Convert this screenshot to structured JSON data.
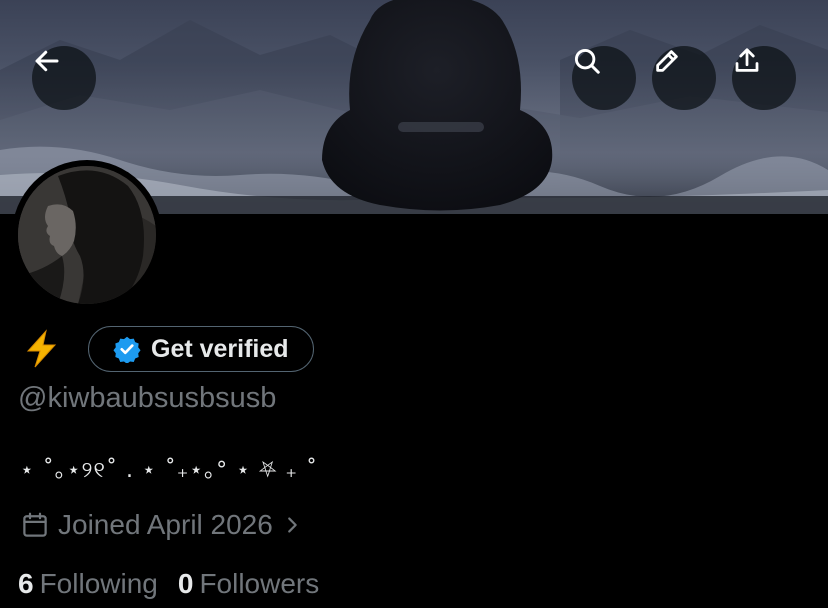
{
  "header": {
    "back_icon": "arrow-left-icon",
    "actions": [
      {
        "icon": "search-icon"
      },
      {
        "icon": "pencil-icon"
      },
      {
        "icon": "share-icon"
      }
    ]
  },
  "profile": {
    "name_emoji": "⚡",
    "verify_label": "Get verified",
    "handle": "@kiwbaubsusbsusb",
    "bio": "⋆ ˚｡⋆୨୧˚ . ⋆ ˚₊⋆｡°  ⋆ ⛧ ₊ ˚",
    "joined": "Joined April 2026",
    "following_count": "6",
    "following_label": "Following",
    "followers_count": "0",
    "followers_label": "Followers"
  },
  "colors": {
    "background": "#000000",
    "text_primary": "#e7e9ea",
    "text_secondary": "#71767b",
    "verified_badge": "#1d9bf0",
    "lightning": "#f5b300"
  }
}
